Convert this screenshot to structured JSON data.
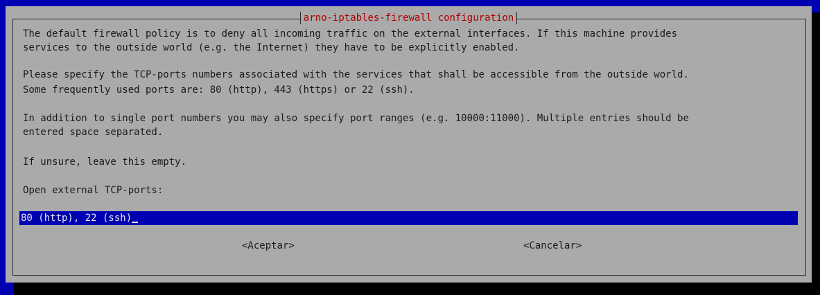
{
  "dialog": {
    "title": "arno-iptables-firewall configuration",
    "paragraphs": [
      "The default firewall policy is to deny all incoming traffic on the external interfaces. If this machine provides",
      "services to the outside world (e.g. the Internet) they have to be explicitly enabled.",
      "Please specify the TCP-ports numbers associated with the services that shall be accessible from the outside world.",
      "Some frequently used ports are: 80 (http), 443 (https) or 22 (ssh).",
      "In addition to single port numbers you may also specify port ranges (e.g. 10000:11000). Multiple entries should be",
      "entered space separated.",
      "If unsure, leave this empty.",
      "Open external TCP-ports:"
    ],
    "input": {
      "value": "80 (http), 22 (ssh)"
    },
    "buttons": {
      "ok_label": "<Aceptar>",
      "cancel_label": "<Cancelar>"
    }
  },
  "colors": {
    "background": "#0000b3",
    "dialog": "#aaaaaa",
    "title": "#b00000",
    "input_bg": "#0000b3",
    "input_text": "#e8e8e8"
  }
}
